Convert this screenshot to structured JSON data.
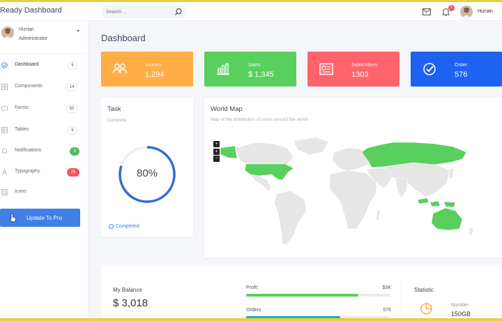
{
  "app": {
    "title": "Ready Dashboard"
  },
  "header": {
    "search_placeholder": "Search ...",
    "notification_count": "5",
    "user_name": "Hizrian"
  },
  "sidebar": {
    "user": {
      "name": "Hizrian",
      "role": "Administrator"
    },
    "items": [
      {
        "label": "Dashboard",
        "badge": "5",
        "icon": "home-icon"
      },
      {
        "label": "Components",
        "badge": "14",
        "icon": "grid-icon"
      },
      {
        "label": "Forms",
        "badge": "50",
        "icon": "form-icon"
      },
      {
        "label": "Tables",
        "badge": "6",
        "icon": "table-icon"
      },
      {
        "label": "Notifications",
        "badge": "3",
        "icon": "bell-icon"
      },
      {
        "label": "Typography",
        "badge": "25",
        "icon": "type-icon"
      },
      {
        "label": "Icons",
        "badge": "",
        "icon": "icons-icon"
      }
    ],
    "update_button": "Update To Pro"
  },
  "main": {
    "title": "Dashboard",
    "stats": [
      {
        "label": "Visitors",
        "value": "1,294",
        "color": "#ffad46",
        "icon": "users-icon"
      },
      {
        "label": "Sales",
        "value": "$ 1,345",
        "color": "#59d05d",
        "icon": "bar-chart-icon"
      },
      {
        "label": "Subscribers",
        "value": "1303",
        "color": "#ff646d",
        "icon": "newspaper-icon"
      },
      {
        "label": "Order",
        "value": "576",
        "color": "#1d62f0",
        "icon": "check-circle-icon"
      }
    ],
    "task": {
      "title": "Task",
      "subtitle": "Complete",
      "percent": "80%",
      "progress": 0.8,
      "legend": "Completed"
    },
    "world_map": {
      "title": "World Map",
      "subtitle": "Map of the distribution of users around the world"
    },
    "balance": {
      "label": "My Balance",
      "value": "$ 3,018"
    },
    "progress": [
      {
        "label": "Profit",
        "value": "$3K",
        "fraction": 0.78,
        "color": "#59d05d"
      },
      {
        "label": "Orders",
        "value": "576",
        "fraction": 0.65,
        "color": "#1ab0b0"
      }
    ],
    "statistic": {
      "title": "Statistic",
      "number_label": "Number",
      "number_value": "150GB"
    }
  },
  "colors": {
    "accent": "#3f7fe6",
    "map_highlight": "#59d05d",
    "map_land": "#e6e6e6"
  }
}
